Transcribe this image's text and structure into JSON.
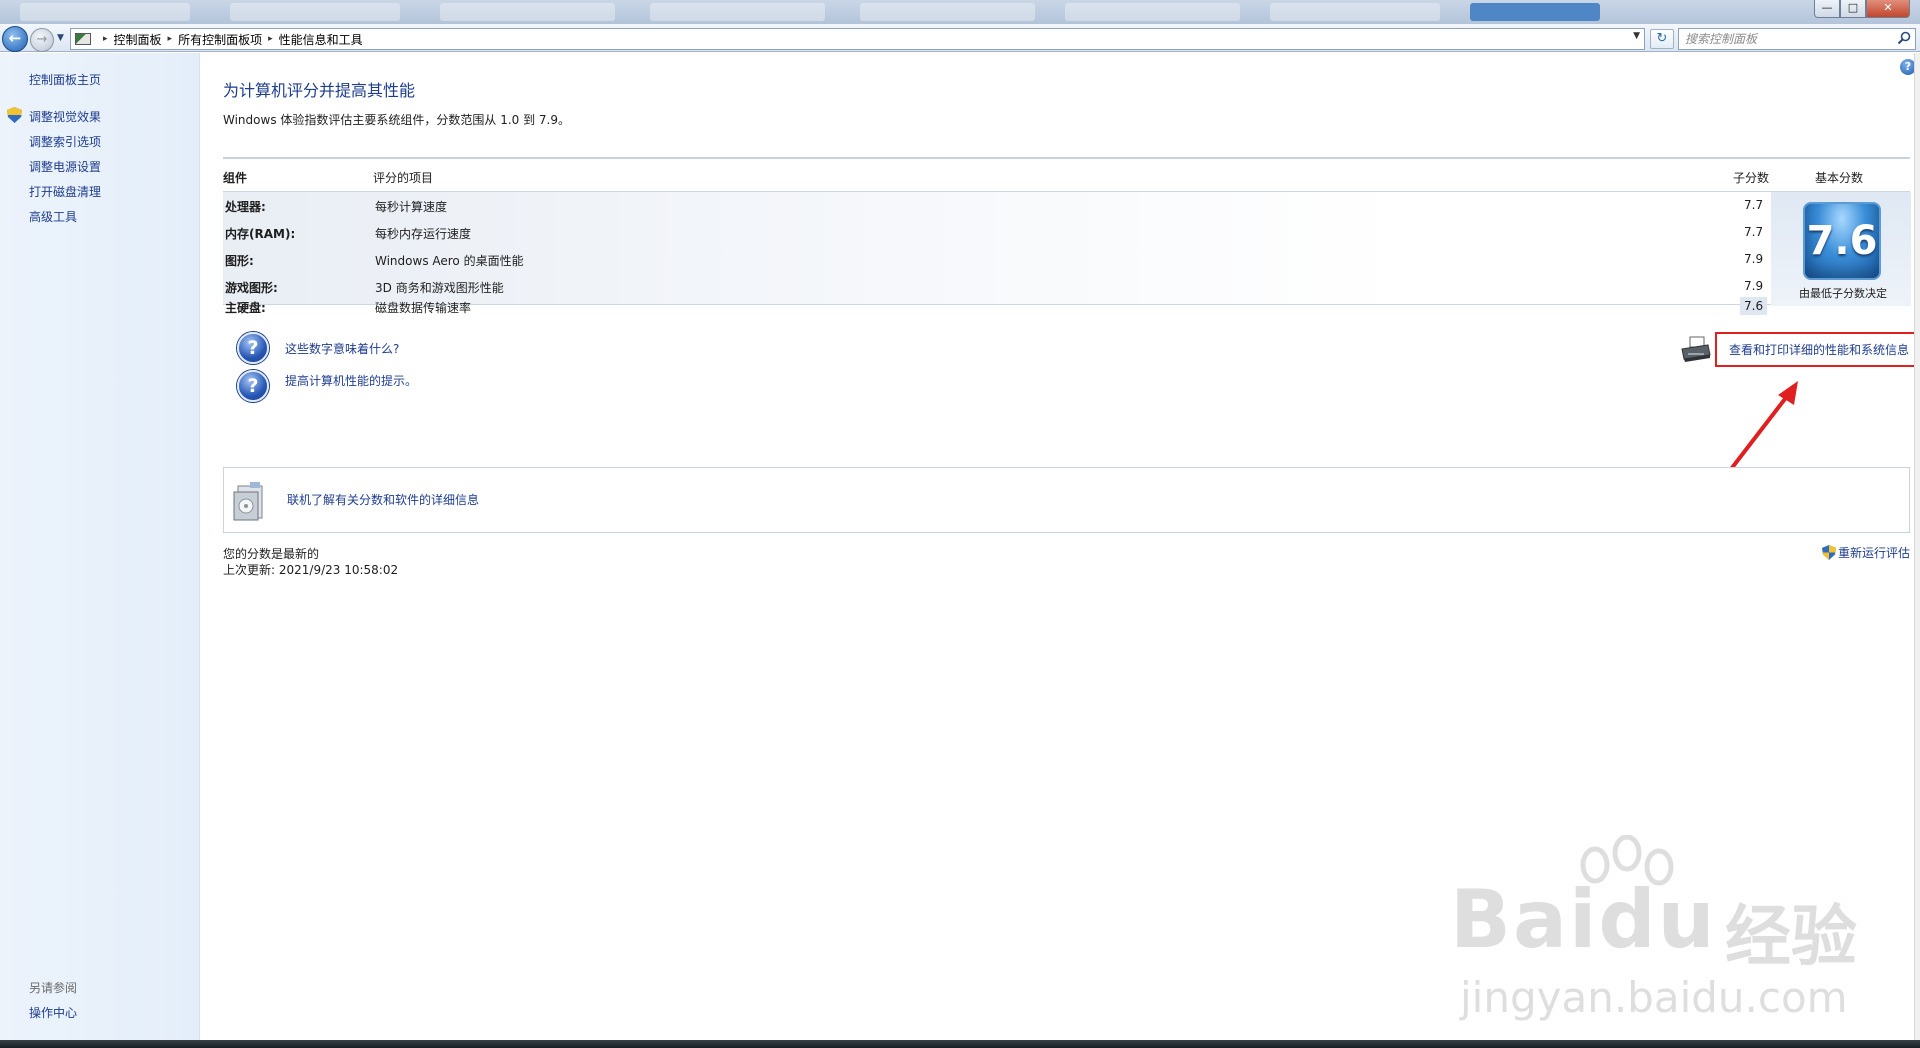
{
  "address_bar": {
    "crumbs": [
      "控制面板",
      "所有控制面板项",
      "性能信息和工具"
    ],
    "search_placeholder": "搜索控制面板"
  },
  "sidebar": {
    "home": "控制面板主页",
    "items": [
      "调整视觉效果",
      "调整索引选项",
      "调整电源设置",
      "打开磁盘清理",
      "高级工具"
    ],
    "see_also_label": "另请参阅",
    "see_also_items": [
      "操作中心"
    ]
  },
  "main": {
    "title": "为计算机评分并提高其性能",
    "description": "Windows 体验指数评估主要系统组件，分数范围从 1.0 到 7.9。",
    "table": {
      "headers": {
        "component": "组件",
        "rated_item": "评分的项目",
        "subscore": "子分数",
        "base_score": "基本分数"
      },
      "rows": [
        {
          "component": "处理器:",
          "item": "每秒计算速度",
          "score": "7.7"
        },
        {
          "component": "内存(RAM):",
          "item": "每秒内存运行速度",
          "score": "7.7"
        },
        {
          "component": "图形:",
          "item": "Windows Aero 的桌面性能",
          "score": "7.9"
        },
        {
          "component": "游戏图形:",
          "item": "3D 商务和游戏图形性能",
          "score": "7.9"
        },
        {
          "component": "主硬盘:",
          "item": "磁盘数据传输速率",
          "score": "7.6"
        }
      ],
      "base_score": "7.6",
      "base_caption": "由最低子分数决定"
    },
    "help_links": [
      "这些数字意味着什么?",
      "提高计算机性能的提示。"
    ],
    "print_link": "查看和打印详细的性能和系统信息",
    "online_link": "联机了解有关分数和软件的详细信息",
    "status": "您的分数是最新的",
    "last_update": "上次更新: 2021/9/23 10:58:02",
    "rerun": "重新运行评估"
  },
  "watermark": {
    "brand": "Bai",
    "brand2": "du",
    "cn": "经验",
    "url": "jingyan.baidu.com"
  },
  "colors": {
    "link": "#1e3d8f",
    "highlight_box": "#e02020",
    "badge": "#3a8ed8"
  }
}
